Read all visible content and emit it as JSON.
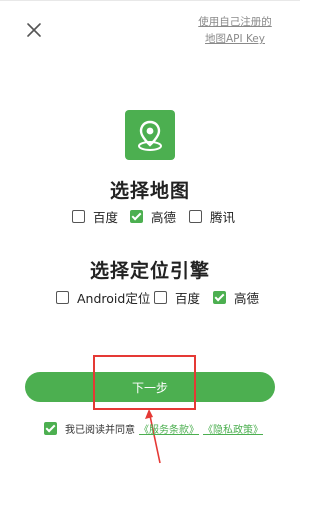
{
  "header": {
    "close_icon": "close-icon",
    "api_link_line1": "使用自己注册的",
    "api_link_line2": "地图API Key"
  },
  "map_section": {
    "icon": "map-pin-icon",
    "title": "选择地图",
    "options": [
      {
        "label": "百度",
        "checked": false
      },
      {
        "label": "高德",
        "checked": true
      },
      {
        "label": "腾讯",
        "checked": false
      }
    ]
  },
  "locate_section": {
    "title": "选择定位引擎",
    "options": [
      {
        "label": "Android定位",
        "checked": false
      },
      {
        "label": "百度",
        "checked": false
      },
      {
        "label": "高德",
        "checked": true
      }
    ]
  },
  "next_button": {
    "label": "下一步"
  },
  "agreement": {
    "checked": true,
    "text": "我已阅读并同意",
    "terms": "《服务条款》",
    "privacy": "《隐私政策》"
  },
  "colors": {
    "accent": "#4caf50",
    "annotation": "#e53935"
  }
}
